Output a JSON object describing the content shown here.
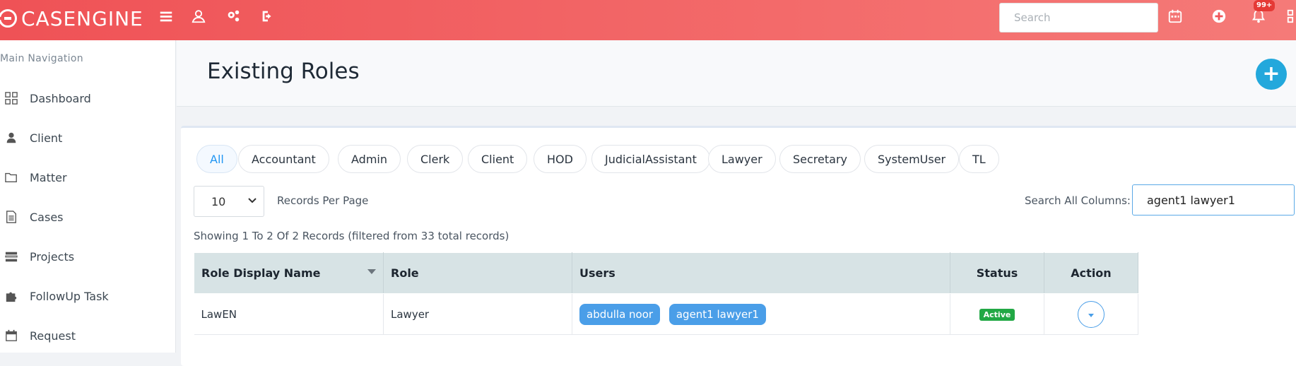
{
  "app": {
    "logo_text": "CASENGINE"
  },
  "topbar": {
    "search_placeholder": "Search",
    "notification_badge": "99+",
    "icons": [
      "menu-icon",
      "user-icon",
      "settings-icon",
      "logout-icon",
      "calendar-icon",
      "add-circle-icon",
      "bell-icon",
      "grid-icon"
    ]
  },
  "sidebar": {
    "heading": "Main Navigation",
    "items": [
      {
        "label": "Dashboard",
        "icon": "dashboard-icon"
      },
      {
        "label": "Client",
        "icon": "user-icon"
      },
      {
        "label": "Matter",
        "icon": "folder-icon"
      },
      {
        "label": "Cases",
        "icon": "document-icon"
      },
      {
        "label": "Projects",
        "icon": "projects-icon"
      },
      {
        "label": "FollowUp Task",
        "icon": "puzzle-icon"
      },
      {
        "label": "Request",
        "icon": "calendar-icon"
      }
    ]
  },
  "page": {
    "title": "Existing Roles"
  },
  "filters": [
    "All",
    "Accountant",
    "Admin",
    "Clerk",
    "Client",
    "HOD",
    "JudicialAssistant",
    "Lawyer",
    "Secretary",
    "SystemUser",
    "TL"
  ],
  "active_filter": "All",
  "controls": {
    "records_per_page_value": "10",
    "records_per_page_label": "Records Per Page",
    "search_label": "Search All Columns:",
    "search_value": "agent1 lawyer1"
  },
  "showing_text": "Showing 1 To 2 Of 2 Records (filtered from 33 total records)",
  "table": {
    "columns": [
      "Role Display Name",
      "Role",
      "Users",
      "Status",
      "Action"
    ],
    "rows": [
      {
        "display_name": "LawEN",
        "role": "Lawyer",
        "users": [
          "abdulla noor",
          "agent1 lawyer1"
        ],
        "status": "Active"
      }
    ]
  },
  "colors": {
    "brand": "#ef5256",
    "accent": "#23a8dc",
    "chip": "#4a9ee8",
    "active": "#22a845"
  }
}
